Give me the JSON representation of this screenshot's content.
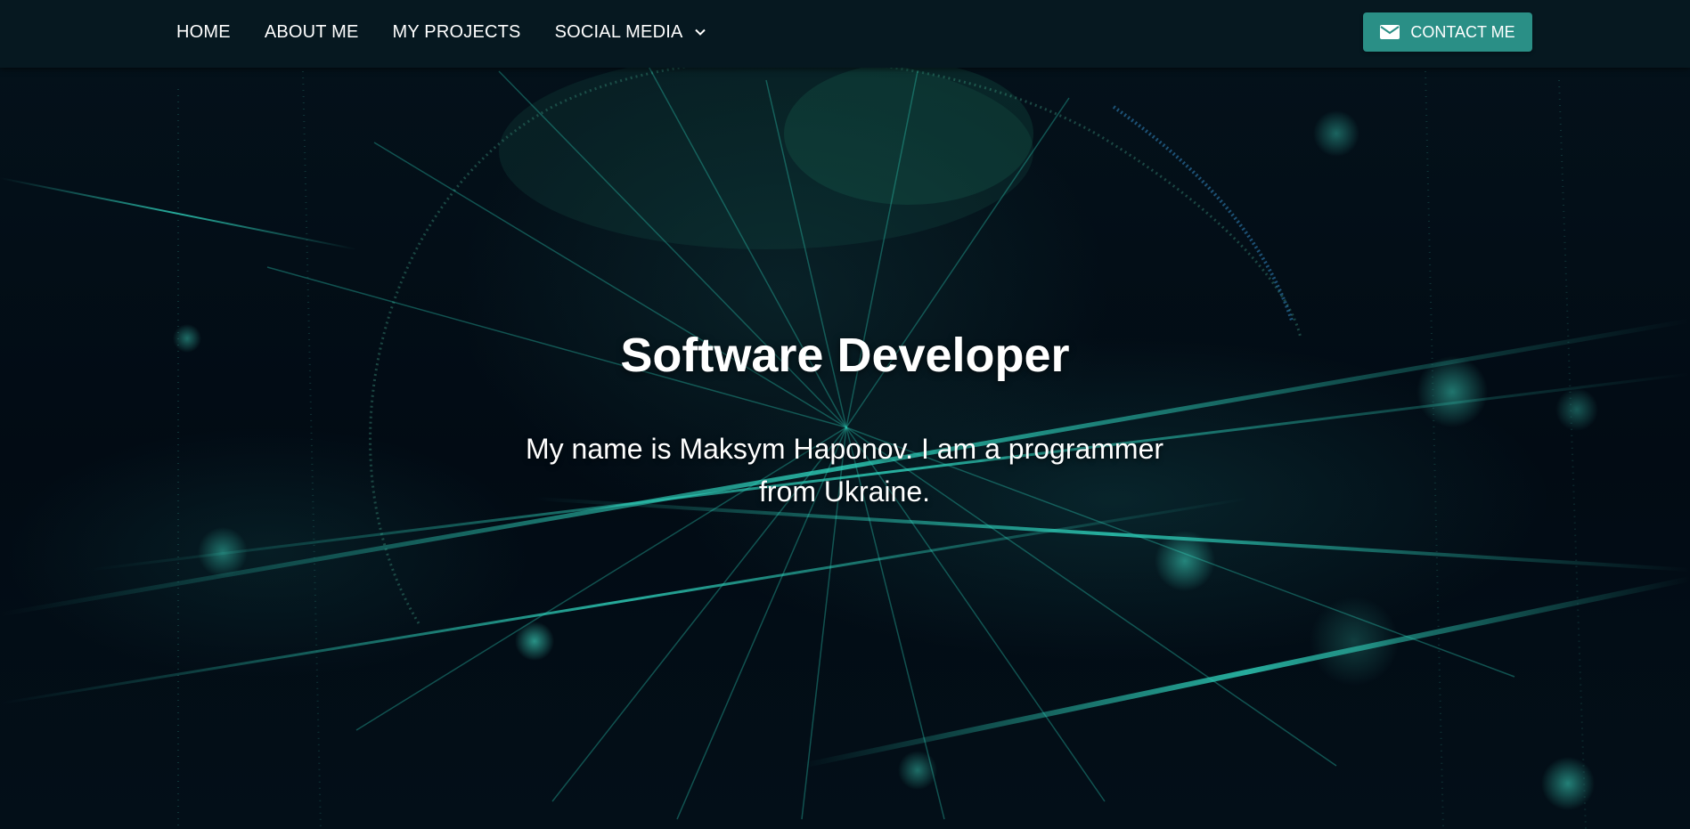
{
  "navbar": {
    "links": [
      {
        "label": "HOME"
      },
      {
        "label": "ABOUT ME"
      },
      {
        "label": "MY PROJECTS"
      },
      {
        "label": "SOCIAL MEDIA",
        "icon": "chevron-down-icon"
      }
    ],
    "contact_button": {
      "label": "CONTACT ME",
      "icon": "mail-icon"
    }
  },
  "hero": {
    "title": "Software Developer",
    "subtitle": "My name is Maksym Haponov. I am a programmer from Ukraine."
  },
  "colors": {
    "navbar_bg": "#061820",
    "accent": "#2a8f86",
    "text": "#ffffff",
    "background": "#030d16"
  }
}
